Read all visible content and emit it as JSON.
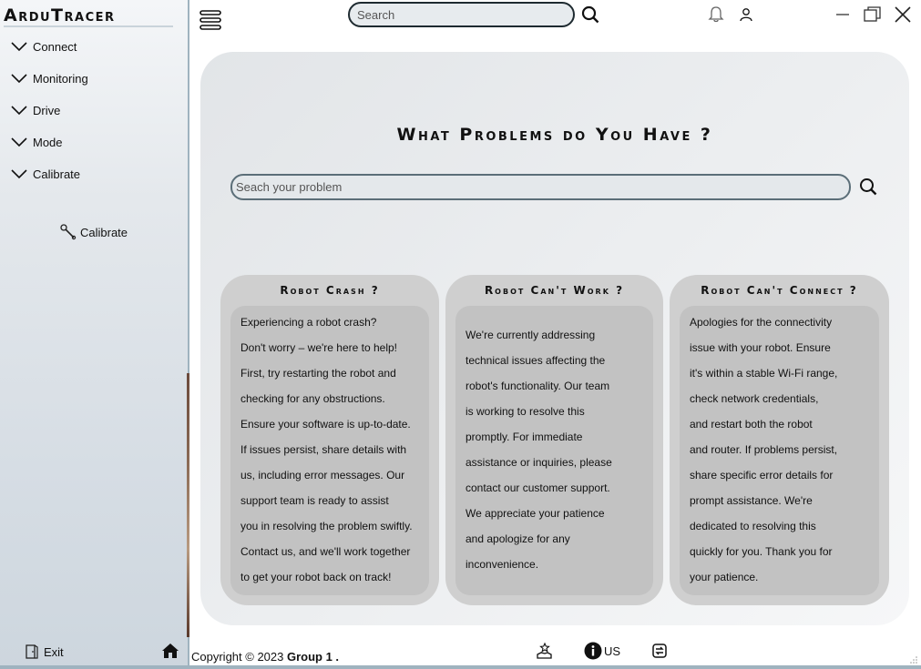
{
  "app": {
    "title": "ArduTracer"
  },
  "sidebar": {
    "items": [
      {
        "label": "Connect"
      },
      {
        "label": "Monitoring"
      },
      {
        "label": "Drive"
      },
      {
        "label": "Mode"
      },
      {
        "label": "Calibrate"
      }
    ],
    "calibrate_button": {
      "label": "Calibrate",
      "icon": "wrench-icon"
    },
    "exit_button": {
      "label": "Exit",
      "icon": "exit-door-icon"
    },
    "home_button": {
      "icon": "home-icon"
    }
  },
  "topbar": {
    "search_placeholder": "Search",
    "icons": [
      "menu-icon",
      "search-icon",
      "bell-icon",
      "user-icon",
      "minimize-icon",
      "maximize-icon",
      "close-icon"
    ]
  },
  "main": {
    "title": "What Problems do You Have ?",
    "search_placeholder": "Seach your problem",
    "cards": [
      {
        "title": "Robot Crash ?",
        "lines": [
          "Experiencing a robot crash?",
          "Don't worry – we're here to help!",
          "First, try restarting the robot and",
          "checking for any obstructions.",
          "Ensure your software is up-to-date.",
          "If issues persist, share details with",
          "us, including error messages. Our",
          "support team is ready to assist",
          "you in resolving the problem swiftly.",
          "Contact us, and we'll work together",
          "to get your robot back on track!"
        ]
      },
      {
        "title": "Robot Can't Work ?",
        "lines": [
          "We're currently addressing",
          "technical issues affecting the",
          "robot's functionality. Our team",
          "is working to resolve this",
          "promptly. For immediate",
          "assistance or inquiries, please",
          "contact our customer support.",
          "We appreciate your patience",
          "and apologize for any",
          "inconvenience."
        ]
      },
      {
        "title": "Robot Can't Connect ?",
        "lines": [
          "Apologies for the connectivity",
          "issue with your robot. Ensure",
          "it's within a stable Wi-Fi range,",
          "check network credentials,",
          "and restart both the robot",
          "and router. If problems persist,",
          "share specific error details for",
          "prompt assistance. We're",
          "dedicated to resolving this",
          "quickly for you. Thank you for",
          "your patience."
        ]
      }
    ]
  },
  "footer": {
    "copyright_prefix": "Copyright © 2023 ",
    "copyright_group": "Group 1 .",
    "info_label": "US",
    "icons": [
      "donate-icon",
      "info-icon",
      "swap-icon"
    ]
  }
}
